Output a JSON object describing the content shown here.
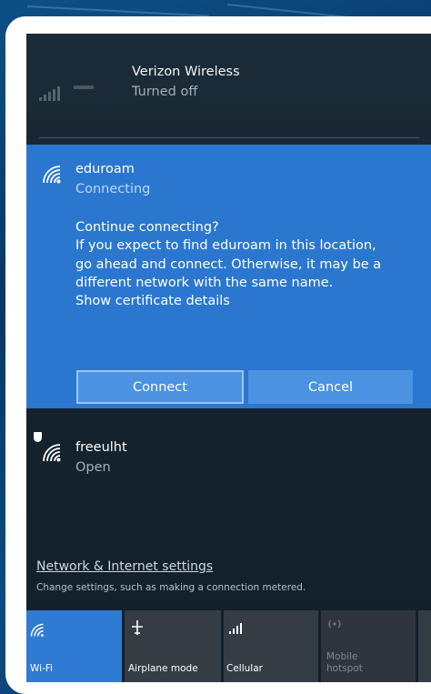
{
  "verizon": {
    "name": "Verizon Wireless",
    "status": "Turned off"
  },
  "eduroam": {
    "name": "eduroam",
    "status": "Connecting",
    "message_lines": [
      "Continue connecting?",
      "If you expect to find eduroam in this location,",
      "go ahead and connect. Otherwise, it may be a",
      "different network with the same name.",
      "Show certificate details"
    ],
    "connect_label": "Connect",
    "cancel_label": "Cancel"
  },
  "freeulht": {
    "name": "freeulht",
    "status": "Open"
  },
  "settings": {
    "link": "Network & Internet settings",
    "sub": "Change settings, such as making a connection metered."
  },
  "quick_actions": {
    "wifi": "Wi-Fi",
    "airplane": "Airplane mode",
    "cellular": "Cellular",
    "hotspot_line1": "Mobile",
    "hotspot_line2": "hotspot"
  },
  "colors": {
    "accent": "#2b77cf",
    "panel_bg": "#1b2c38",
    "tile_active": "#2f7bd3",
    "tile_inactive": "#353d44"
  },
  "icons": {
    "cellular": "cellular-signal-icon",
    "wifi": "wifi-icon",
    "shield": "shield-icon",
    "airplane": "airplane-icon",
    "hotspot": "hotspot-icon"
  }
}
